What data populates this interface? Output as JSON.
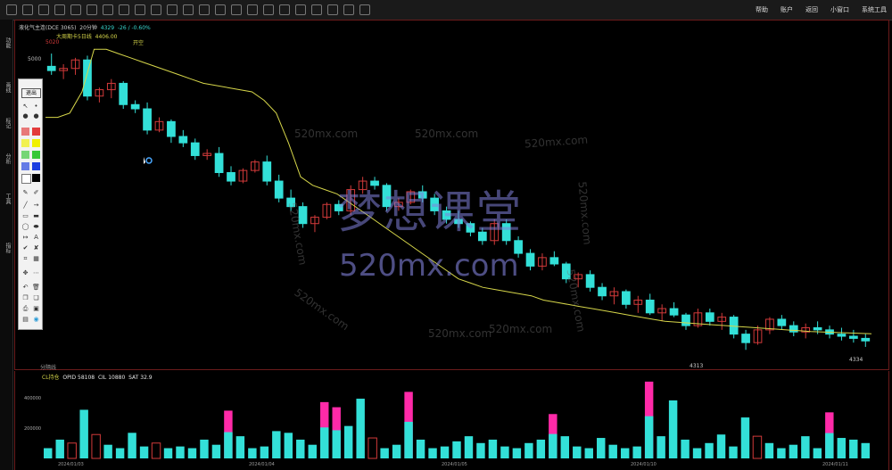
{
  "toolbar": {
    "menu": [
      "帮助",
      "账户",
      "返回",
      "小窗口",
      "系统工具"
    ]
  },
  "left_rail": [
    "功能",
    "画线",
    "标记",
    "分析",
    "工具",
    "指标"
  ],
  "chart_header": {
    "instrument": "液化气主连(DCE 3065)",
    "period": "20分钟",
    "price": "4329",
    "change": "-26 / -0.60%",
    "indicator": "大周期卡5日线",
    "indicator_value": "4406.00",
    "ylabel_top": "5020",
    "ylabel_5000": "5000"
  },
  "markers": {
    "open_label": "开空",
    "low_label": "4313",
    "last_label": "4334"
  },
  "palette": {
    "title": "退出",
    "colors": [
      "#e23b3b",
      "#f0f000",
      "#38c838",
      "#1c3fe0",
      "#000000"
    ]
  },
  "volume_panel": {
    "tab_label": "分隔线",
    "indicator": "CL持仓",
    "opid_label": "OPID",
    "opid": "58108",
    "cl_label": "CIL",
    "cl": "10880",
    "sat_label": "SAT",
    "sat": "32.9",
    "ytick_top": "400000",
    "ytick_mid": "200000"
  },
  "dates": [
    "2024/01/03",
    "2024/01/04",
    "2024/01/05",
    "2024/01/10",
    "2024/01/11"
  ],
  "watermark": {
    "title": "梦想课堂",
    "url": "520mx.com",
    "tile": "520mx.com"
  },
  "chart_data": {
    "type": "candlestick",
    "candles": [
      [
        0,
        1,
        1,
        -1
      ],
      [
        1,
        1,
        1,
        -1
      ],
      [
        2,
        1,
        0.6,
        -1
      ],
      [
        3,
        1,
        1,
        -1
      ],
      [
        4,
        1,
        1,
        -1
      ],
      [
        5,
        1,
        1,
        -1
      ],
      [
        6,
        1,
        1,
        -1
      ],
      [
        7,
        1,
        1,
        -1
      ],
      [
        8,
        1,
        1,
        -1
      ],
      [
        9,
        1,
        1,
        -1
      ],
      [
        10,
        1,
        0.5,
        -1
      ],
      [
        11,
        1,
        1,
        -1
      ],
      [
        12,
        1,
        1,
        -1
      ],
      [
        13,
        1,
        1,
        -1
      ],
      [
        14,
        1,
        1,
        -1
      ],
      [
        15,
        1,
        1,
        -1
      ],
      [
        16,
        1,
        1,
        -1
      ],
      [
        17,
        1,
        1,
        -1
      ],
      [
        18,
        1,
        1,
        -1
      ],
      [
        19,
        1,
        1,
        -1
      ]
    ],
    "ohlc": [
      [
        4980,
        5010,
        4960,
        4970
      ],
      [
        4970,
        4985,
        4950,
        4975
      ],
      [
        4975,
        5000,
        4960,
        4995
      ],
      [
        4995,
        5005,
        4900,
        4910
      ],
      [
        4910,
        4930,
        4895,
        4925
      ],
      [
        4925,
        4950,
        4905,
        4940
      ],
      [
        4940,
        4945,
        4880,
        4890
      ],
      [
        4890,
        4900,
        4870,
        4880
      ],
      [
        4880,
        4895,
        4820,
        4830
      ],
      [
        4830,
        4860,
        4825,
        4850
      ],
      [
        4850,
        4855,
        4800,
        4815
      ],
      [
        4815,
        4830,
        4790,
        4800
      ],
      [
        4800,
        4810,
        4760,
        4770
      ],
      [
        4770,
        4785,
        4760,
        4775
      ],
      [
        4775,
        4790,
        4720,
        4730
      ],
      [
        4730,
        4745,
        4700,
        4710
      ],
      [
        4710,
        4740,
        4705,
        4735
      ],
      [
        4735,
        4760,
        4730,
        4755
      ],
      [
        4755,
        4770,
        4700,
        4710
      ],
      [
        4710,
        4725,
        4660,
        4670
      ],
      [
        4670,
        4690,
        4640,
        4650
      ],
      [
        4650,
        4660,
        4600,
        4610
      ],
      [
        4610,
        4630,
        4590,
        4625
      ],
      [
        4625,
        4660,
        4620,
        4655
      ],
      [
        4655,
        4665,
        4630,
        4640
      ],
      [
        4640,
        4700,
        4630,
        4690
      ],
      [
        4690,
        4720,
        4680,
        4710
      ],
      [
        4710,
        4720,
        4690,
        4700
      ],
      [
        4700,
        4705,
        4640,
        4650
      ],
      [
        4650,
        4670,
        4640,
        4660
      ],
      [
        4660,
        4690,
        4655,
        4685
      ],
      [
        4685,
        4700,
        4660,
        4670
      ],
      [
        4670,
        4680,
        4630,
        4640
      ],
      [
        4640,
        4650,
        4610,
        4620
      ],
      [
        4620,
        4640,
        4600,
        4610
      ],
      [
        4610,
        4615,
        4580,
        4590
      ],
      [
        4590,
        4600,
        4560,
        4570
      ],
      [
        4570,
        4620,
        4560,
        4610
      ],
      [
        4610,
        4620,
        4560,
        4570
      ],
      [
        4570,
        4580,
        4530,
        4540
      ],
      [
        4540,
        4550,
        4500,
        4510
      ],
      [
        4510,
        4540,
        4500,
        4530
      ],
      [
        4530,
        4545,
        4510,
        4515
      ],
      [
        4515,
        4520,
        4470,
        4480
      ],
      [
        4480,
        4495,
        4460,
        4490
      ],
      [
        4490,
        4500,
        4450,
        4460
      ],
      [
        4460,
        4470,
        4430,
        4440
      ],
      [
        4440,
        4460,
        4420,
        4450
      ],
      [
        4450,
        4455,
        4410,
        4420
      ],
      [
        4420,
        4440,
        4400,
        4430
      ],
      [
        4430,
        4445,
        4395,
        4400
      ],
      [
        4400,
        4420,
        4380,
        4410
      ],
      [
        4410,
        4425,
        4390,
        4395
      ],
      [
        4395,
        4400,
        4360,
        4370
      ],
      [
        4370,
        4410,
        4365,
        4400
      ],
      [
        4400,
        4410,
        4370,
        4380
      ],
      [
        4380,
        4400,
        4360,
        4390
      ],
      [
        4390,
        4395,
        4340,
        4350
      ],
      [
        4350,
        4360,
        4313,
        4330
      ],
      [
        4330,
        4370,
        4325,
        4360
      ],
      [
        4360,
        4390,
        4350,
        4385
      ],
      [
        4385,
        4395,
        4360,
        4370
      ],
      [
        4370,
        4380,
        4345,
        4355
      ],
      [
        4355,
        4375,
        4340,
        4365
      ],
      [
        4365,
        4380,
        4350,
        4360
      ],
      [
        4360,
        4370,
        4340,
        4350
      ],
      [
        4350,
        4365,
        4335,
        4345
      ],
      [
        4345,
        4360,
        4330,
        4340
      ],
      [
        4340,
        4350,
        4320,
        4334
      ]
    ],
    "signal_line": [
      4860,
      4860,
      4870,
      4920,
      5020,
      5020,
      5010,
      5000,
      4990,
      4980,
      4970,
      4960,
      4950,
      4940,
      4935,
      4930,
      4925,
      4920,
      4900,
      4870,
      4800,
      4720,
      4700,
      4690,
      4680,
      4660,
      4640,
      4620,
      4600,
      4580,
      4560,
      4540,
      4520,
      4500,
      4480,
      4470,
      4460,
      4455,
      4450,
      4445,
      4440,
      4430,
      4425,
      4420,
      4415,
      4410,
      4405,
      4400,
      4395,
      4390,
      4385,
      4380,
      4378,
      4376,
      4374,
      4372,
      4370,
      4368,
      4366,
      4364,
      4362,
      4360,
      4358,
      4356,
      4355,
      4354,
      4353,
      4352,
      4351
    ],
    "volume": [
      [
        60000,
        "c"
      ],
      [
        110000,
        "c"
      ],
      [
        90000,
        "r"
      ],
      [
        285000,
        "c"
      ],
      [
        140000,
        "r"
      ],
      [
        80000,
        "c"
      ],
      [
        60000,
        "c"
      ],
      [
        150000,
        "c"
      ],
      [
        70000,
        "c"
      ],
      [
        90000,
        "r"
      ],
      [
        60000,
        "c"
      ],
      [
        70000,
        "c"
      ],
      [
        60000,
        "c"
      ],
      [
        110000,
        "c"
      ],
      [
        80000,
        "c"
      ],
      [
        280000,
        "m"
      ],
      [
        130000,
        "c"
      ],
      [
        60000,
        "c"
      ],
      [
        70000,
        "c"
      ],
      [
        160000,
        "c"
      ],
      [
        150000,
        "c"
      ],
      [
        110000,
        "c"
      ],
      [
        80000,
        "c"
      ],
      [
        330000,
        "m"
      ],
      [
        300000,
        "m"
      ],
      [
        190000,
        "c"
      ],
      [
        350000,
        "c"
      ],
      [
        120000,
        "r"
      ],
      [
        60000,
        "c"
      ],
      [
        80000,
        "c"
      ],
      [
        390000,
        "m"
      ],
      [
        110000,
        "c"
      ],
      [
        60000,
        "c"
      ],
      [
        70000,
        "c"
      ],
      [
        100000,
        "c"
      ],
      [
        130000,
        "c"
      ],
      [
        90000,
        "c"
      ],
      [
        110000,
        "c"
      ],
      [
        70000,
        "c"
      ],
      [
        60000,
        "c"
      ],
      [
        90000,
        "c"
      ],
      [
        110000,
        "c"
      ],
      [
        260000,
        "m"
      ],
      [
        130000,
        "c"
      ],
      [
        70000,
        "c"
      ],
      [
        60000,
        "c"
      ],
      [
        120000,
        "c"
      ],
      [
        80000,
        "c"
      ],
      [
        60000,
        "c"
      ],
      [
        70000,
        "c"
      ],
      [
        450000,
        "m"
      ],
      [
        130000,
        "c"
      ],
      [
        340000,
        "c"
      ],
      [
        110000,
        "c"
      ],
      [
        60000,
        "c"
      ],
      [
        90000,
        "c"
      ],
      [
        140000,
        "c"
      ],
      [
        70000,
        "c"
      ],
      [
        240000,
        "c"
      ],
      [
        130000,
        "r"
      ],
      [
        90000,
        "c"
      ],
      [
        60000,
        "c"
      ],
      [
        80000,
        "c"
      ],
      [
        130000,
        "c"
      ],
      [
        60000,
        "c"
      ],
      [
        270000,
        "m"
      ],
      [
        120000,
        "c"
      ],
      [
        110000,
        "c"
      ],
      [
        90000,
        "c"
      ]
    ]
  }
}
